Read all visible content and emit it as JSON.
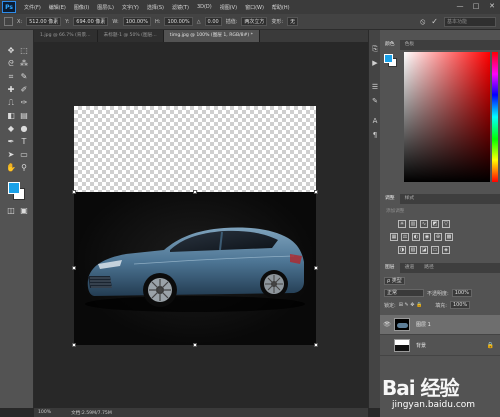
{
  "app": {
    "logo": "Ps"
  },
  "menu": [
    "文件(F)",
    "编辑(E)",
    "图像(I)",
    "图层(L)",
    "文字(Y)",
    "选择(S)",
    "滤镜(T)",
    "3D(D)",
    "视图(V)",
    "窗口(W)",
    "帮助(H)"
  ],
  "window_controls": {
    "minimize": "—",
    "maximize": "□",
    "close": "✕"
  },
  "options_bar": {
    "x_label": "X:",
    "x_value": "512.00 像素",
    "y_label": "Y:",
    "y_value": "694.00 像素",
    "w_label": "W:",
    "w_value": "100.00%",
    "h_label": "H:",
    "h_value": "100.00%",
    "angle_label": "△",
    "angle_value": "0.00",
    "interp_label": "插值:",
    "interp_value": "两次立方",
    "warp_label": "变形:",
    "warp_value": "无",
    "search_placeholder": "基本功能"
  },
  "doc_tabs": [
    {
      "label": "1.jpg @ 66.7% (背景…",
      "active": false
    },
    {
      "label": "未标题-1 @ 50% (图层…",
      "active": false
    },
    {
      "label": "timg.jpg @ 100% (图层 1, RGB/8#) *",
      "active": true
    }
  ],
  "status": {
    "zoom": "100%",
    "doc_info": "文档:2.59M/7.75M"
  },
  "panels": {
    "color_tabs": [
      "颜色",
      "色板"
    ],
    "adjust_tabs": [
      "调整",
      "样式"
    ],
    "adjust_hint": "添加调整",
    "layers_tabs": [
      "图层",
      "通道",
      "路径"
    ],
    "kind_label": "ρ 类型",
    "blend_mode": "正常",
    "opacity_label": "不透明度:",
    "opacity_value": "100%",
    "lock_label": "锁定:",
    "fill_label": "填充:",
    "fill_value": "100%",
    "layers": [
      {
        "name": "图层 1",
        "selected": true
      },
      {
        "name": "背景",
        "selected": false
      }
    ],
    "colors": {
      "foreground": "#1aa1e8",
      "background": "#ffffff"
    }
  },
  "watermark": {
    "brand": "Bai 经验",
    "url": "jingyan.baidu.com"
  }
}
